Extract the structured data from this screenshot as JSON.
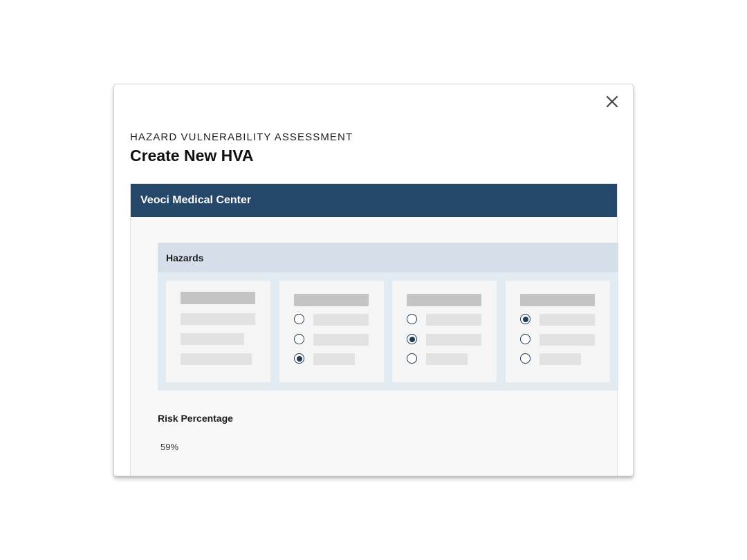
{
  "modal": {
    "eyebrow": "HAZARD VULNERABILITY ASSESSMENT",
    "title": "Create New HVA",
    "close_icon": "close-icon"
  },
  "panel": {
    "header": "Veoci Medical Center"
  },
  "hazards": {
    "header": "Hazards",
    "groups": [
      {
        "selected_option": null
      },
      {
        "selected_option": 3
      },
      {
        "selected_option": 2
      },
      {
        "selected_option": 1
      }
    ]
  },
  "risk": {
    "label": "Risk Percentage",
    "value": "59%"
  },
  "colors": {
    "header_bg": "#24476a",
    "hazards_header_bg": "#d4dfe9",
    "hazards_bg": "#e3ebf2",
    "radio": "#1f3a55"
  }
}
